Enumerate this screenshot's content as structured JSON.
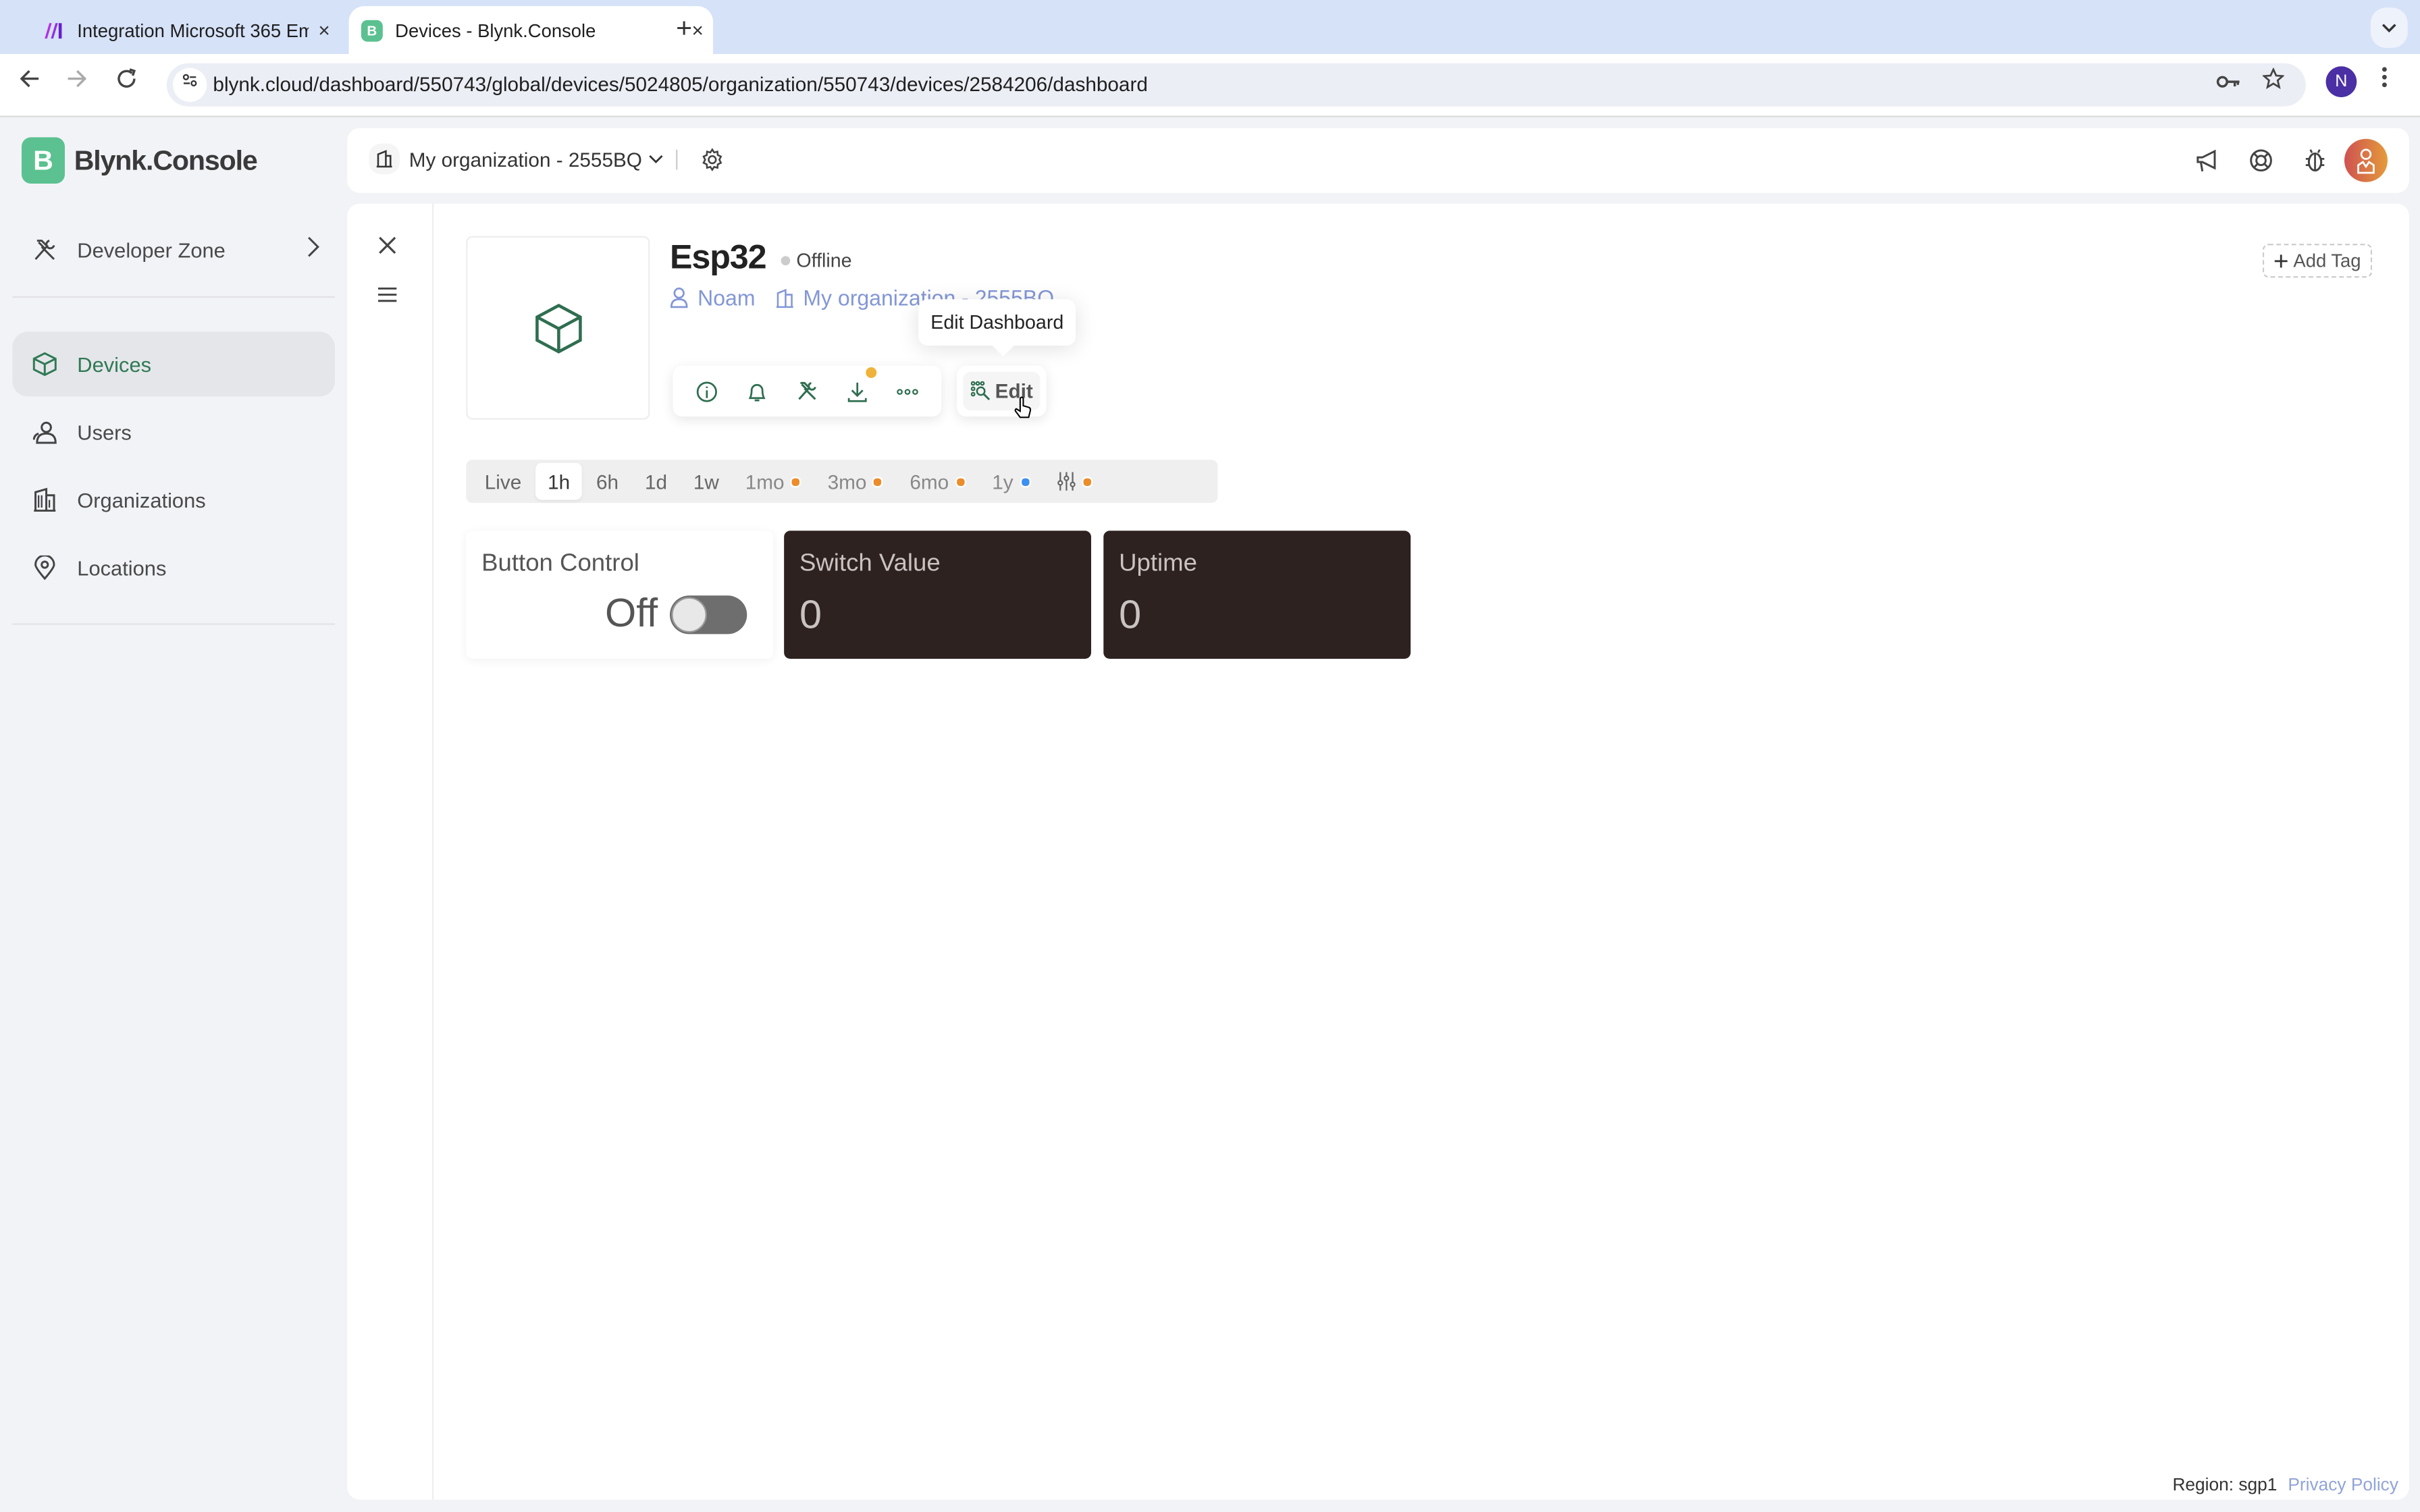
{
  "browser": {
    "tabs": [
      {
        "title": "Integration Microsoft 365 Em",
        "favicon": "make-logo",
        "active": false
      },
      {
        "title": "Devices - Blynk.Console",
        "favicon": "B",
        "active": true
      }
    ],
    "new_tab": "+",
    "close": "×",
    "url": "blynk.cloud/dashboard/550743/global/devices/5024805/organization/550743/devices/2584206/dashboard",
    "profile_initial": "N"
  },
  "app": {
    "logo_letter": "B",
    "logo_text": "Blynk.Console"
  },
  "sidebar": {
    "developer_zone": "Developer Zone",
    "items": [
      {
        "label": "Devices",
        "icon": "cube-icon",
        "active": true
      },
      {
        "label": "Users",
        "icon": "users-icon",
        "active": false
      },
      {
        "label": "Organizations",
        "icon": "building-icon",
        "active": false
      },
      {
        "label": "Locations",
        "icon": "location-pin-icon",
        "active": false
      }
    ]
  },
  "header": {
    "organization": "My organization - 2555BQ"
  },
  "device": {
    "name": "Esp32",
    "status": "Offline",
    "owner": "Noam",
    "organization": "My organization - 2555BQ",
    "add_tag": "Add Tag",
    "edit_label": "Edit",
    "tooltip": "Edit Dashboard"
  },
  "time_ranges": [
    {
      "label": "Live",
      "selected": false,
      "dim": false,
      "dot": null
    },
    {
      "label": "1h",
      "selected": true,
      "dim": false,
      "dot": null
    },
    {
      "label": "6h",
      "selected": false,
      "dim": false,
      "dot": null
    },
    {
      "label": "1d",
      "selected": false,
      "dim": false,
      "dot": null
    },
    {
      "label": "1w",
      "selected": false,
      "dim": false,
      "dot": null
    },
    {
      "label": "1mo",
      "selected": false,
      "dim": true,
      "dot": "#ec8c2b"
    },
    {
      "label": "3mo",
      "selected": false,
      "dim": true,
      "dot": "#ec8c2b"
    },
    {
      "label": "6mo",
      "selected": false,
      "dim": true,
      "dot": "#ec8c2b"
    },
    {
      "label": "1y",
      "selected": false,
      "dim": true,
      "dot": "#3d8ff0"
    }
  ],
  "custom_range_dot": "#ec8c2b",
  "widgets": {
    "button_control": {
      "title": "Button Control",
      "state": "Off",
      "on": false
    },
    "switch_value": {
      "title": "Switch Value",
      "value": "0"
    },
    "uptime": {
      "title": "Uptime",
      "value": "0"
    }
  },
  "footer": {
    "region": "Region: sgp1",
    "privacy": "Privacy Policy"
  },
  "colors": {
    "brand_green": "#5bc190",
    "active_green": "#2f7a55",
    "link_blue": "#8397d6",
    "widget_dark": "#2e2220",
    "badge_yellow": "#efb23a"
  }
}
